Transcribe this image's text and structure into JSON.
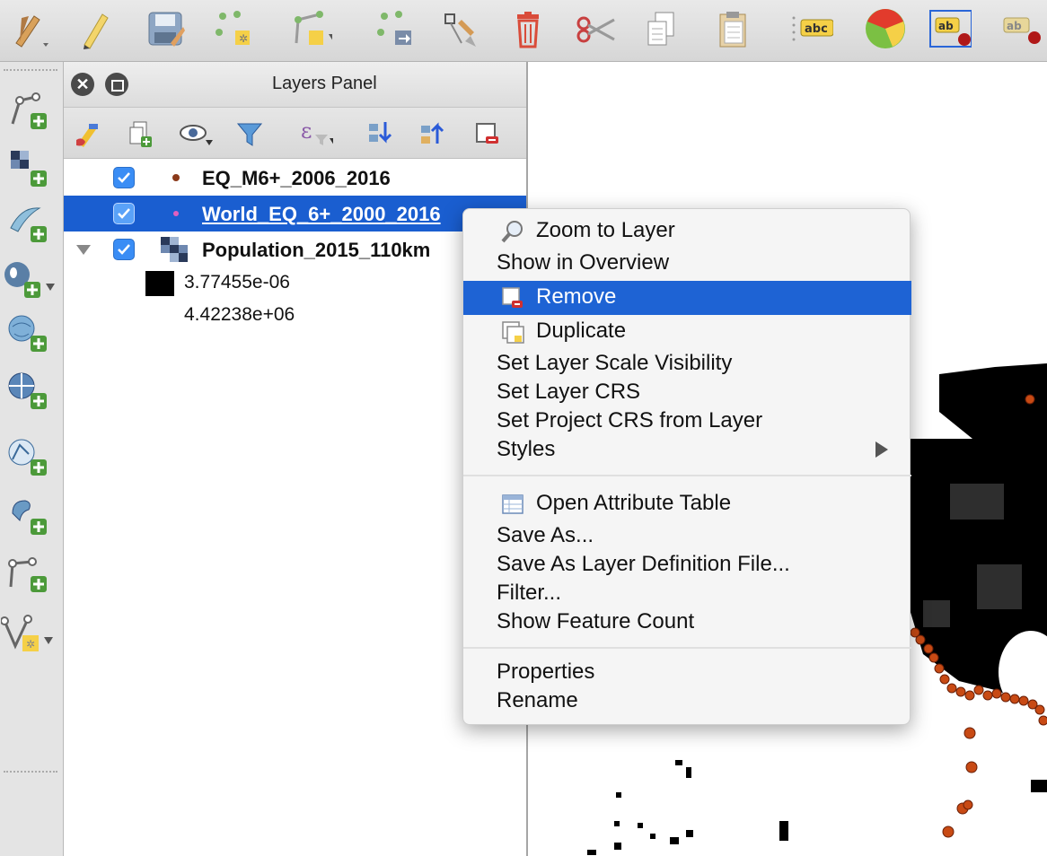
{
  "panel": {
    "title": "Layers Panel"
  },
  "layers": [
    {
      "name": "EQ_M6+_2006_2016",
      "checked": true,
      "selected": false
    },
    {
      "name": "World_EQ_6+_2000_2016",
      "checked": true,
      "selected": true
    },
    {
      "name": "Population_2015_110km",
      "checked": true,
      "selected": false,
      "expanded": true
    }
  ],
  "legend": [
    "3.77455e-06",
    "4.42238e+06"
  ],
  "context_menu": {
    "items": [
      {
        "label": "Zoom to Layer",
        "icon": "zoom-icon"
      },
      {
        "label": "Show in Overview"
      },
      {
        "label": "Remove",
        "icon": "remove-layer-icon",
        "highlighted": true
      },
      {
        "label": "Duplicate",
        "icon": "duplicate-icon"
      },
      {
        "label": "Set Layer Scale Visibility"
      },
      {
        "label": "Set Layer CRS"
      },
      {
        "label": "Set Project CRS from Layer"
      },
      {
        "label": "Styles",
        "submenu": true
      },
      {
        "label": "Open Attribute Table",
        "icon": "attribute-table-icon"
      },
      {
        "label": "Save As..."
      },
      {
        "label": "Save As Layer Definition File..."
      },
      {
        "label": "Filter..."
      },
      {
        "label": "Show Feature Count"
      },
      {
        "label": "Properties"
      },
      {
        "label": "Rename"
      }
    ]
  },
  "toolbar_icons": [
    "pencil-dropdown-icon",
    "edit-pencil-icon",
    "save-edits-icon",
    "add-point-icon",
    "add-line-icon",
    "move-feature-icon",
    "node-tool-icon",
    "delete-icon",
    "cut-icon",
    "copy-icon",
    "paste-icon",
    "label-abc-icon",
    "pie-diagram-icon",
    "pin-label-icon",
    "move-label-icon"
  ],
  "left_toolbar_icons": [
    "add-vector-layer-icon",
    "add-raster-layer-icon",
    "add-delimited-text-icon",
    "add-postgis-layer-icon",
    "add-wms-layer-icon",
    "add-wcs-layer-icon",
    "add-wfs-layer-icon",
    "add-spatialite-icon",
    "add-mssql-icon",
    "new-layer-icon"
  ],
  "colors": {
    "selection": "#1a5ed0",
    "menu_highlight": "#1e63d4",
    "quake_point": "#c84a14",
    "checkbox": "#3a8df5"
  }
}
